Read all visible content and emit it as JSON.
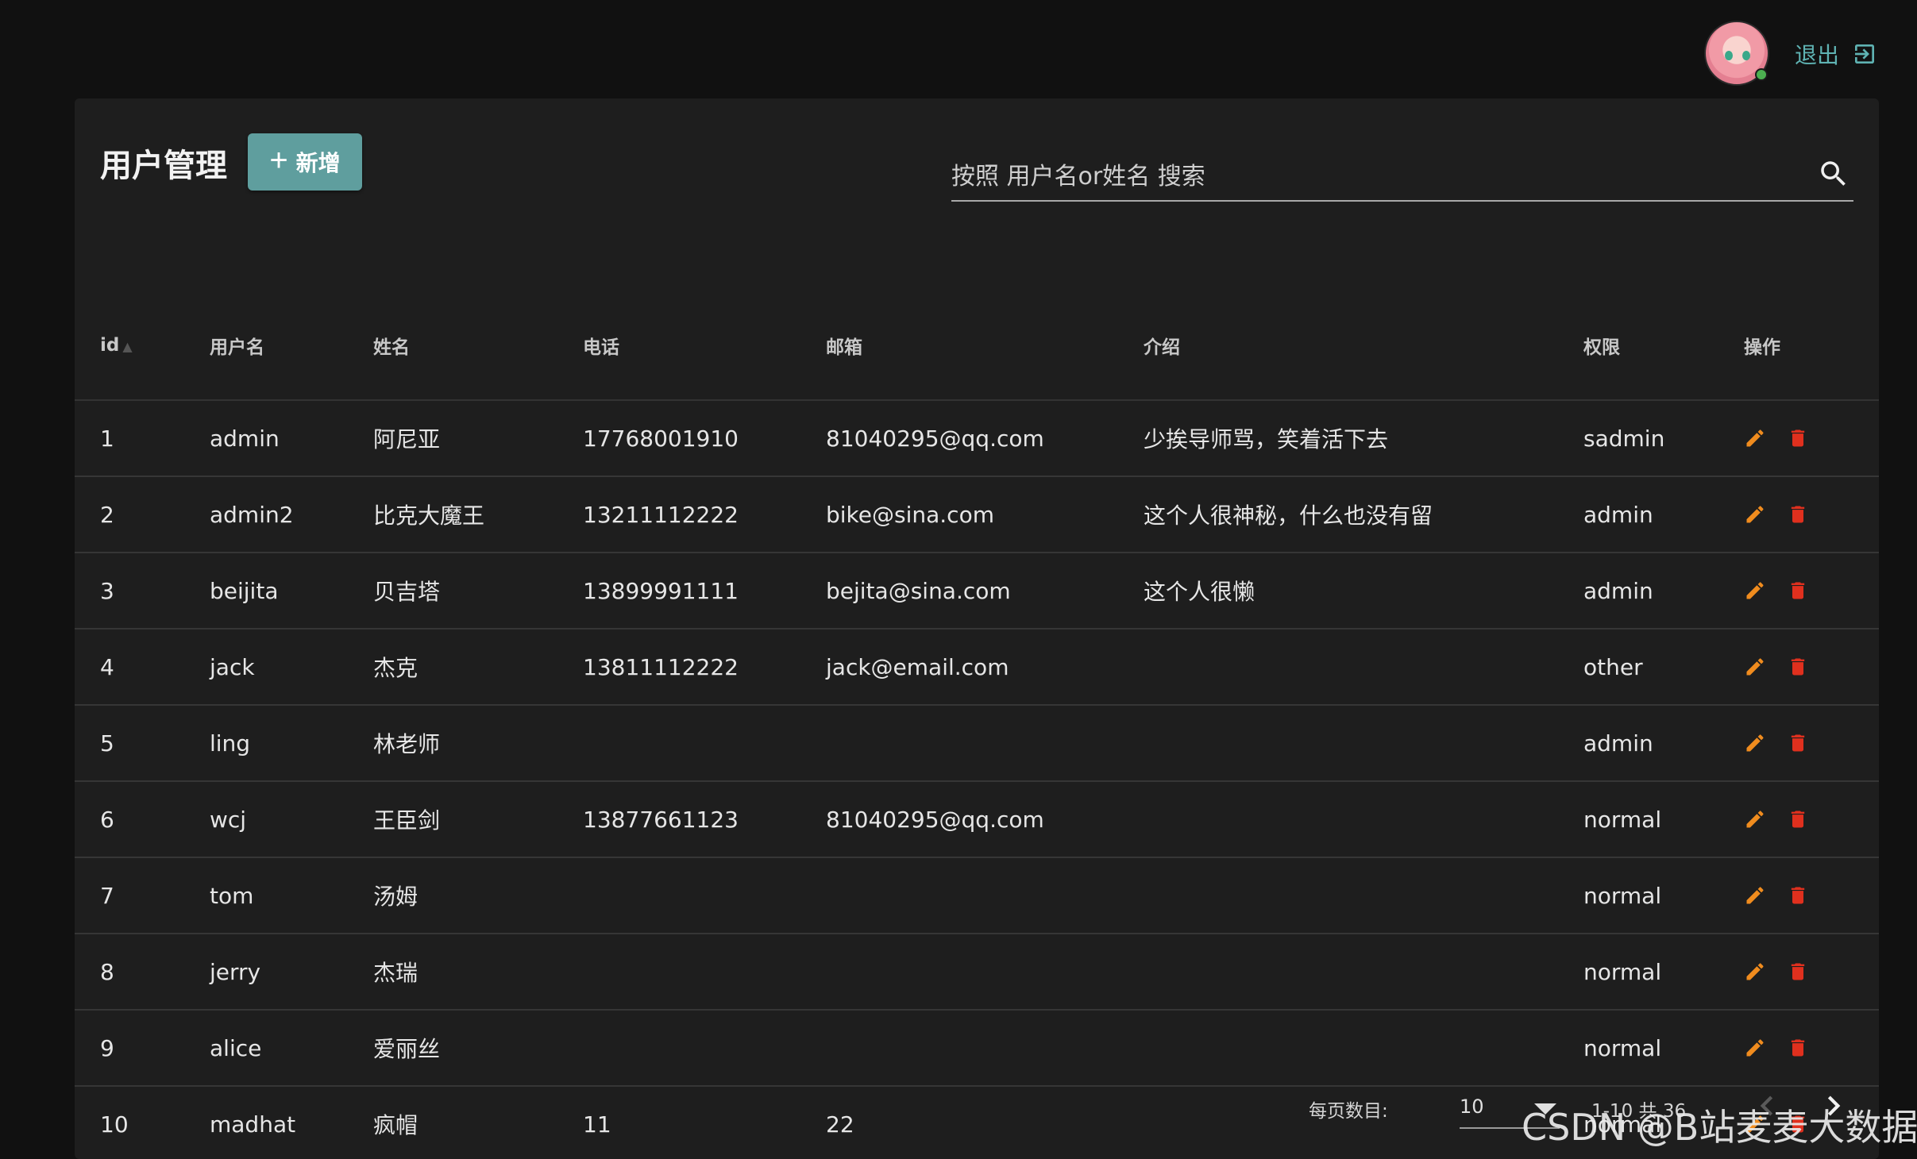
{
  "header": {
    "logout_label": "退出"
  },
  "toolbar": {
    "title": "用户管理",
    "add_label": "新增",
    "search_placeholder": "按照 用户名or姓名 搜索"
  },
  "table": {
    "columns": [
      "id",
      "用户名",
      "姓名",
      "电话",
      "邮箱",
      "介绍",
      "权限",
      "操作"
    ],
    "rows": [
      {
        "id": "1",
        "username": "admin",
        "name": "阿尼亚",
        "phone": "17768001910",
        "email": "81040295@qq.com",
        "intro": "少挨导师骂，笑着活下去",
        "role": "sadmin"
      },
      {
        "id": "2",
        "username": "admin2",
        "name": "比克大魔王",
        "phone": "13211112222",
        "email": "bike@sina.com",
        "intro": "这个人很神秘，什么也没有留",
        "role": "admin"
      },
      {
        "id": "3",
        "username": "beijita",
        "name": "贝吉塔",
        "phone": "13899991111",
        "email": "bejita@sina.com",
        "intro": "这个人很懒",
        "role": "admin"
      },
      {
        "id": "4",
        "username": "jack",
        "name": "杰克",
        "phone": "13811112222",
        "email": "jack@email.com",
        "intro": "",
        "role": "other"
      },
      {
        "id": "5",
        "username": "ling",
        "name": "林老师",
        "phone": "",
        "email": "",
        "intro": "",
        "role": "admin"
      },
      {
        "id": "6",
        "username": "wcj",
        "name": "王臣剑",
        "phone": "13877661123",
        "email": "81040295@qq.com",
        "intro": "",
        "role": "normal"
      },
      {
        "id": "7",
        "username": "tom",
        "name": "汤姆",
        "phone": "",
        "email": "",
        "intro": "",
        "role": "normal"
      },
      {
        "id": "8",
        "username": "jerry",
        "name": "杰瑞",
        "phone": "",
        "email": "",
        "intro": "",
        "role": "normal"
      },
      {
        "id": "9",
        "username": "alice",
        "name": "爱丽丝",
        "phone": "",
        "email": "",
        "intro": "",
        "role": "normal"
      },
      {
        "id": "10",
        "username": "madhat",
        "name": "疯帽",
        "phone": "11",
        "email": "22",
        "intro": "",
        "role": "normal"
      }
    ]
  },
  "pagination": {
    "per_page_label": "每页数目:",
    "per_page_value": "10",
    "range_text": "1-10 共 36"
  },
  "watermark": "CSDN @B站麦麦大数据",
  "colors": {
    "accent": "#5f9e9e",
    "edit": "#f08c1e",
    "delete": "#e0301e",
    "online": "#4caf50"
  }
}
